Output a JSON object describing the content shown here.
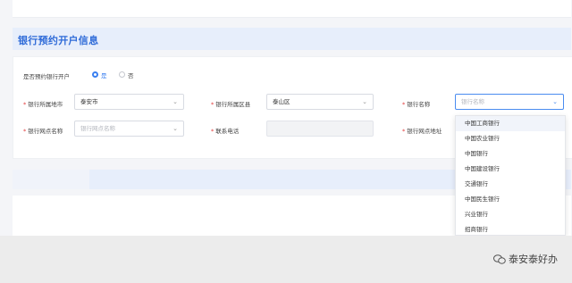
{
  "section_title": "银行预约开户信息",
  "form": {
    "appointment_question": "是否预约银行开户",
    "option_yes": "是",
    "option_no": "否",
    "city_label": "银行所属地市",
    "city_value": "泰安市",
    "district_label": "银行所属区县",
    "district_value": "泰山区",
    "bank_name_label": "银行名称",
    "bank_name_placeholder": "银行名称",
    "branch_label": "银行网点名称",
    "branch_placeholder": "银行网点名称",
    "phone_label": "联系电话",
    "address_label": "银行网点地址"
  },
  "dropdown": {
    "items": [
      "中国工商银行",
      "中国农业银行",
      "中国银行",
      "中国建设银行",
      "交通银行",
      "中国民生银行",
      "兴业银行",
      "招商银行"
    ]
  },
  "watermark": {
    "text": "泰安泰好办"
  },
  "icons": {
    "chevron": "chevron-down-icon",
    "watermark_logo": "wechat-icon"
  }
}
